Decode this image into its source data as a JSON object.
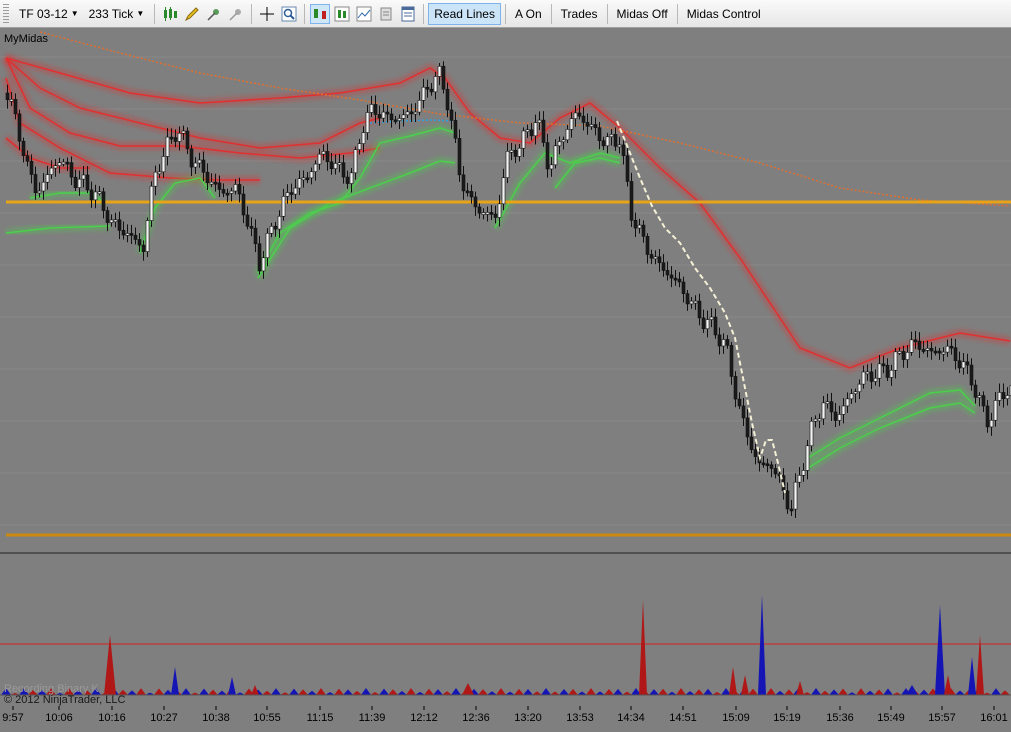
{
  "toolbar": {
    "instrument": "TF 03-12",
    "interval": "233 Tick",
    "buttons": {
      "read_lines": "Read Lines",
      "a_on": "A On",
      "trades": "Trades",
      "midas_off": "Midas Off",
      "midas_control": "Midas Control"
    }
  },
  "chart": {
    "indicator_label": "MyMidas",
    "watermark": "Recording Binary K",
    "copyright": "© 2012 NinjaTrader, LLC",
    "time_ticks": [
      "9:57",
      "10:06",
      "10:16",
      "10:27",
      "10:38",
      "10:55",
      "11:15",
      "11:39",
      "12:12",
      "12:36",
      "13:20",
      "13:53",
      "14:34",
      "14:51",
      "15:09",
      "15:19",
      "15:36",
      "15:49",
      "15:57",
      "16:01"
    ],
    "colors": {
      "background": "#7f7f7f",
      "red_band": "#e03030",
      "green_band": "#4ccf4c",
      "orange_level": "#e8a317",
      "bull_candle": "#f2f2f2",
      "bear_candle": "#1a1a1a",
      "volume_red": "#b01818",
      "volume_blue": "#1515b5"
    }
  }
}
